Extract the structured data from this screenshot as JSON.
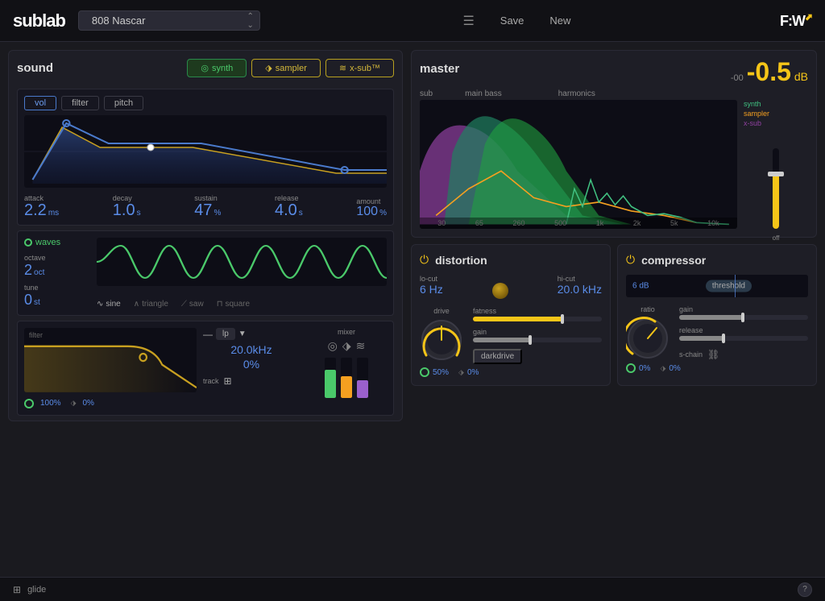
{
  "app": {
    "logo_prefix": "sub",
    "logo_suffix": "lab",
    "brand": "F:W"
  },
  "topbar": {
    "preset_name": "808 Nascar",
    "save_label": "Save",
    "new_label": "New"
  },
  "sound": {
    "title": "sound",
    "tab_synth": "synth",
    "tab_sampler": "sampler",
    "tab_xsub": "x-sub™",
    "env_vol": "vol",
    "env_filter": "filter",
    "env_pitch": "pitch",
    "attack_label": "attack",
    "attack_value": "2.2",
    "attack_unit": "ms",
    "decay_label": "decay",
    "decay_value": "1.0",
    "decay_unit": "s",
    "sustain_label": "sustain",
    "sustain_value": "47",
    "sustain_unit": "%",
    "release_label": "release",
    "release_value": "4.0",
    "release_unit": "s",
    "amount_label": "amount",
    "amount_value": "100",
    "amount_unit": "%"
  },
  "waves": {
    "title": "waves",
    "octave_label": "octave",
    "octave_value": "2",
    "octave_unit": "oct",
    "tune_label": "tune",
    "tune_value": "0",
    "tune_unit": "st",
    "sine": "sine",
    "triangle": "triangle",
    "saw": "saw",
    "square": "square"
  },
  "filter_section": {
    "label": "filter",
    "type": "lp",
    "freq": "20.0kHz",
    "percent": "0%",
    "vol_value": "100%",
    "mix_value": "0%",
    "track_label": "track"
  },
  "mixer": {
    "label": "mixer"
  },
  "master": {
    "title": "master",
    "db_label": "-00",
    "db_value": "-0.5",
    "db_unit": "dB",
    "off_label": "off",
    "sub_label": "sub",
    "main_bass_label": "main bass",
    "harmonics_label": "harmonics",
    "synth_label": "synth",
    "sampler_label": "sampler",
    "xsub_label": "x-sub",
    "freq_labels": [
      "30",
      "65",
      "260",
      "500",
      "1k",
      "2k",
      "5k",
      "10k"
    ]
  },
  "distortion": {
    "title": "distortion",
    "locut_label": "lo-cut",
    "locut_value": "6 Hz",
    "hicut_label": "hi-cut",
    "hicut_value": "20.0 kHz",
    "drive_label": "drive",
    "fatness_label": "fatness",
    "gain_label": "gain",
    "darkdrive_label": "darkdrive",
    "on_value": "50%",
    "mix_value": "0%"
  },
  "compressor": {
    "title": "compressor",
    "threshold_label": "threshold",
    "threshold_value": "6 dB",
    "ratio_label": "ratio",
    "gain_label": "gain",
    "release_label": "release",
    "schain_label": "s-chain",
    "on_value": "0%",
    "mix_value": "0%"
  },
  "statusbar": {
    "glide_label": "glide",
    "help_label": "?"
  }
}
